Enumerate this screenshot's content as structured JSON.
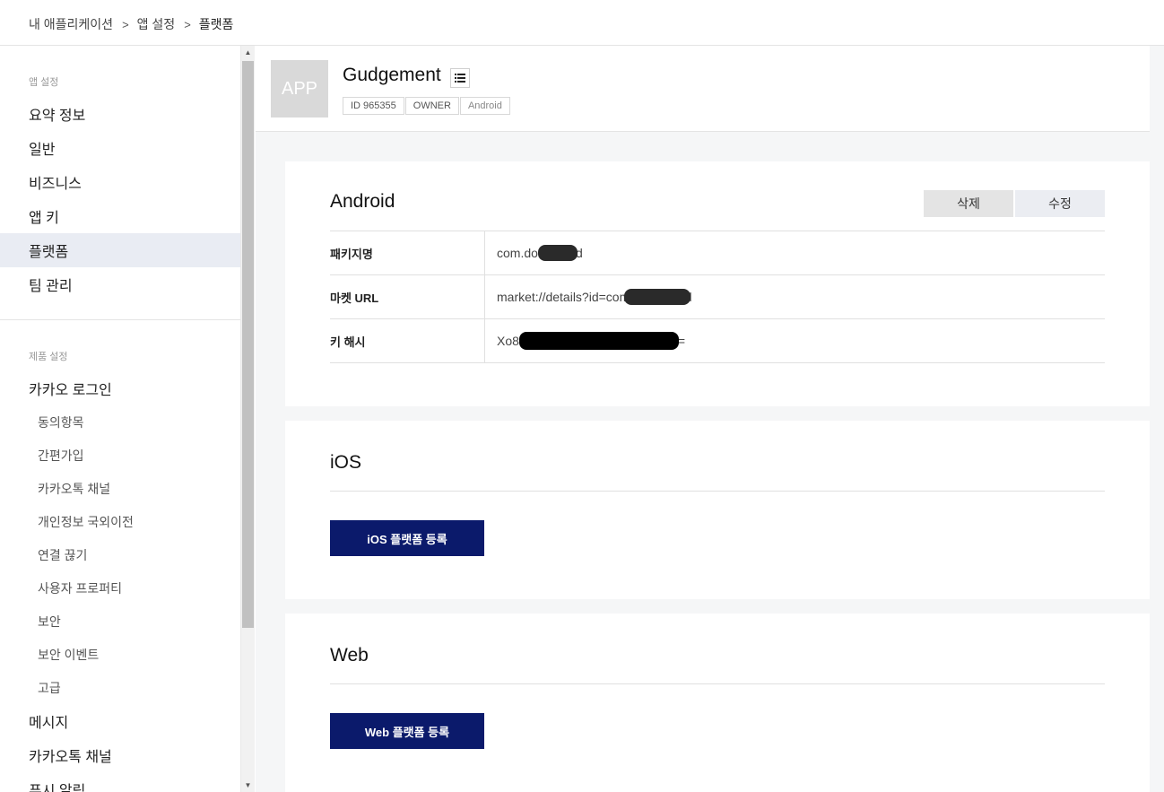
{
  "breadcrumb": {
    "items": [
      "내 애플리케이션",
      "앱 설정",
      "플랫폼"
    ],
    "separator": ">"
  },
  "sidebar": {
    "app_settings_label": "앱 설정",
    "app_items": [
      "요약 정보",
      "일반",
      "비즈니스",
      "앱 키",
      "플랫폼",
      "팀 관리"
    ],
    "active_item": "플랫폼",
    "product_settings_label": "제품 설정",
    "kakao_login": "카카오 로그인",
    "kakao_login_sub": [
      "동의항목",
      "간편가입",
      "카카오톡 채널",
      "개인정보 국외이전",
      "연결 끊기",
      "사용자 프로퍼티",
      "보안",
      "보안 이벤트",
      "고급"
    ],
    "more_items": [
      "메시지",
      "카카오톡 채널",
      "푸시 알림"
    ]
  },
  "app": {
    "thumb_text": "APP",
    "name": "Gudgement",
    "badges": [
      "ID 965355",
      "OWNER",
      "Android"
    ]
  },
  "android": {
    "title": "Android",
    "delete_label": "삭제",
    "edit_label": "수정",
    "rows": [
      {
        "label": "패키지명",
        "value": "com.dontspend"
      },
      {
        "label": "마켓 URL",
        "value": "market://details?id=com.dontspend"
      },
      {
        "label": "키 해시",
        "value": "Xo8",
        "value_tail": "9iU="
      }
    ]
  },
  "ios": {
    "title": "iOS",
    "button": "iOS 플랫폼 등록"
  },
  "web": {
    "title": "Web",
    "button": "Web 플랫폼 등록"
  },
  "colors": {
    "primary_button": "#0b1a6b",
    "active_nav_bg": "#e9ecf3",
    "main_bg": "#f5f6f7"
  }
}
